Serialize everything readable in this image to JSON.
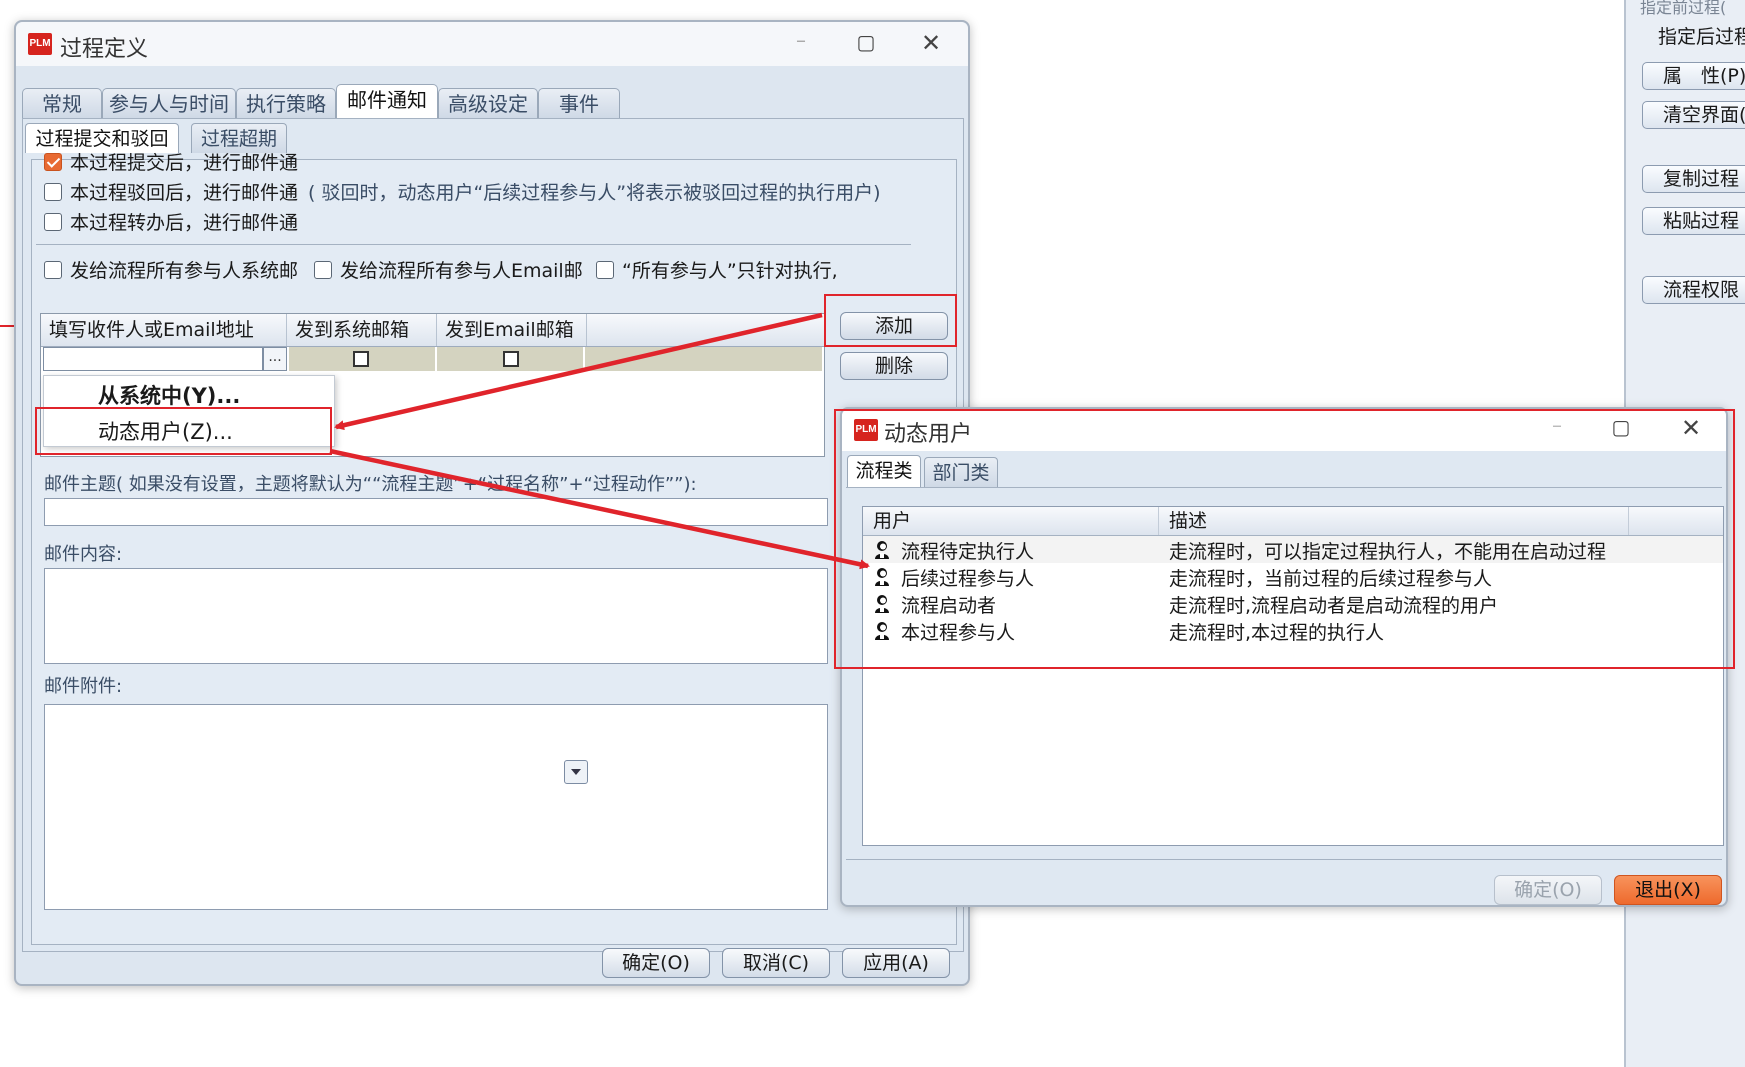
{
  "side_panel": {
    "top_text": "指定前过程(",
    "buttons": [
      "指定后过程(",
      "属　性(P)",
      "清空界面(L",
      "复制过程",
      "粘贴过程",
      "流程权限"
    ]
  },
  "main_dialog": {
    "logo": "PLM",
    "title": "过程定义",
    "tabs": [
      "常规",
      "参与人与时间",
      "执行策略",
      "邮件通知",
      "高级设定",
      "事件"
    ],
    "subtabs": [
      "过程提交和驳回",
      "过程超期"
    ],
    "options": [
      {
        "label": "本过程提交后，进行邮件通",
        "checked": true
      },
      {
        "label": "本过程驳回后，进行邮件通",
        "hint": "( 驳回时，动态用户“后续过程参与人”将表示被驳回过程的执行用户)",
        "checked": false
      },
      {
        "label": "本过程转办后，进行邮件通",
        "checked": false
      }
    ],
    "send_options": [
      {
        "label": "发给流程所有参与人系统邮",
        "checked": false
      },
      {
        "label": "发给流程所有参与人Email邮",
        "checked": false
      },
      {
        "label": "“所有参与人”只针对执行,",
        "checked": false
      }
    ],
    "grid": {
      "columns": [
        "填写收件人或Email地址",
        "发到系统邮箱",
        "发到Email邮箱"
      ],
      "ellipsis": "..."
    },
    "context_menu": [
      "从系统中(Y)...",
      "动态用户(Z)..."
    ],
    "add_button": "添加",
    "delete_button": "删除",
    "subject_label": "邮件主题( 如果没有设置，主题将默认为““流程主题”+“过程名称”+“过程动作””):",
    "content_label": "邮件内容:",
    "attachment_label": "邮件附件:",
    "footer": [
      "确定(O)",
      "取消(C)",
      "应用(A)"
    ]
  },
  "dynamic_dialog": {
    "logo": "PLM",
    "title": "动态用户",
    "tabs": [
      "流程类",
      "部门类"
    ],
    "columns": [
      "用户",
      "描述"
    ],
    "rows": [
      {
        "user": "流程待定执行人",
        "desc": "走流程时，可以指定过程执行人，不能用在启动过程"
      },
      {
        "user": "后续过程参与人",
        "desc": "走流程时，当前过程的后续过程参与人"
      },
      {
        "user": "流程启动者",
        "desc": "走流程时,流程启动者是启动流程的用户"
      },
      {
        "user": "本过程参与人",
        "desc": "走流程时,本过程的执行人"
      }
    ],
    "ok_button": "确定(O)",
    "exit_button": "退出(X)"
  },
  "colors": {
    "annotation": "#e0242b",
    "exit_button": "#f0703a",
    "checkbox_checked": "#e86a32",
    "logo": "#d6241e"
  }
}
